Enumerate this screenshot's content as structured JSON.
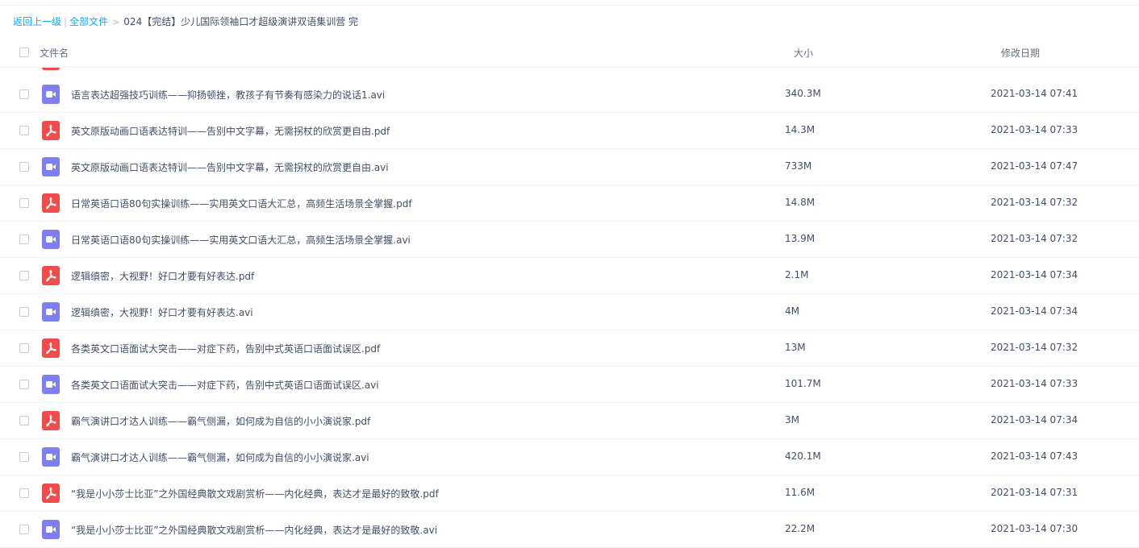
{
  "breadcrumb": {
    "back": "返回上一级",
    "separator": "|",
    "all_files": "全部文件",
    "arrow": ">",
    "current": "024【完结】少儿国际领袖口才超级演讲双语集训营 完"
  },
  "table": {
    "columns": {
      "name": "文件名",
      "size": "大小",
      "date": "修改日期"
    },
    "rows": [
      {
        "type": "video-icon",
        "name": "语言表达超强技巧训练——抑扬顿挫，教孩子有节奏有感染力的说话1.avi",
        "size": "340.3M",
        "date": "2021-03-14 07:41"
      },
      {
        "type": "pdf-icon",
        "name": "英文原版动画口语表达特训——告别中文字幕，无需拐杖的欣赏更自由.pdf",
        "size": "14.3M",
        "date": "2021-03-14 07:33"
      },
      {
        "type": "video-icon",
        "name": "英文原版动画口语表达特训——告别中文字幕，无需拐杖的欣赏更自由.avi",
        "size": "733M",
        "date": "2021-03-14 07:47"
      },
      {
        "type": "pdf-icon",
        "name": "日常英语口语80句实操训练——实用英文口语大汇总，高频生活场景全掌握.pdf",
        "size": "14.8M",
        "date": "2021-03-14 07:32"
      },
      {
        "type": "video-icon",
        "name": "日常英语口语80句实操训练——实用英文口语大汇总，高频生活场景全掌握.avi",
        "size": "13.9M",
        "date": "2021-03-14 07:32"
      },
      {
        "type": "pdf-icon",
        "name": "逻辑缜密，大视野！好口才要有好表达.pdf",
        "size": "2.1M",
        "date": "2021-03-14 07:34"
      },
      {
        "type": "video-icon",
        "name": "逻辑缜密，大视野！好口才要有好表达.avi",
        "size": "4M",
        "date": "2021-03-14 07:34"
      },
      {
        "type": "pdf-icon",
        "name": "各类英文口语面试大突击——对症下药，告别中式英语口语面试误区.pdf",
        "size": "13M",
        "date": "2021-03-14 07:32"
      },
      {
        "type": "video-icon",
        "name": "各类英文口语面试大突击——对症下药，告别中式英语口语面试误区.avi",
        "size": "101.7M",
        "date": "2021-03-14 07:33"
      },
      {
        "type": "pdf-icon",
        "name": "霸气演讲口才达人训练——霸气侧漏，如何成为自信的小小演说家.pdf",
        "size": "3M",
        "date": "2021-03-14 07:34"
      },
      {
        "type": "video-icon",
        "name": "霸气演讲口才达人训练——霸气侧漏，如何成为自信的小小演说家.avi",
        "size": "420.1M",
        "date": "2021-03-14 07:43"
      },
      {
        "type": "pdf-icon",
        "name": "“我是小小莎士比亚”之外国经典散文戏剧赏析——内化经典，表达才是最好的致敬.pdf",
        "size": "11.6M",
        "date": "2021-03-14 07:31"
      },
      {
        "type": "video-icon",
        "name": "“我是小小莎士比亚”之外国经典散文戏剧赏析——内化经典，表达才是最好的致敬.avi",
        "size": "22.2M",
        "date": "2021-03-14 07:30"
      }
    ]
  },
  "colors": {
    "link": "#09aaff",
    "video_icon": "#7d7ff2",
    "pdf_icon": "#f24b4b",
    "text": "#424e67"
  }
}
